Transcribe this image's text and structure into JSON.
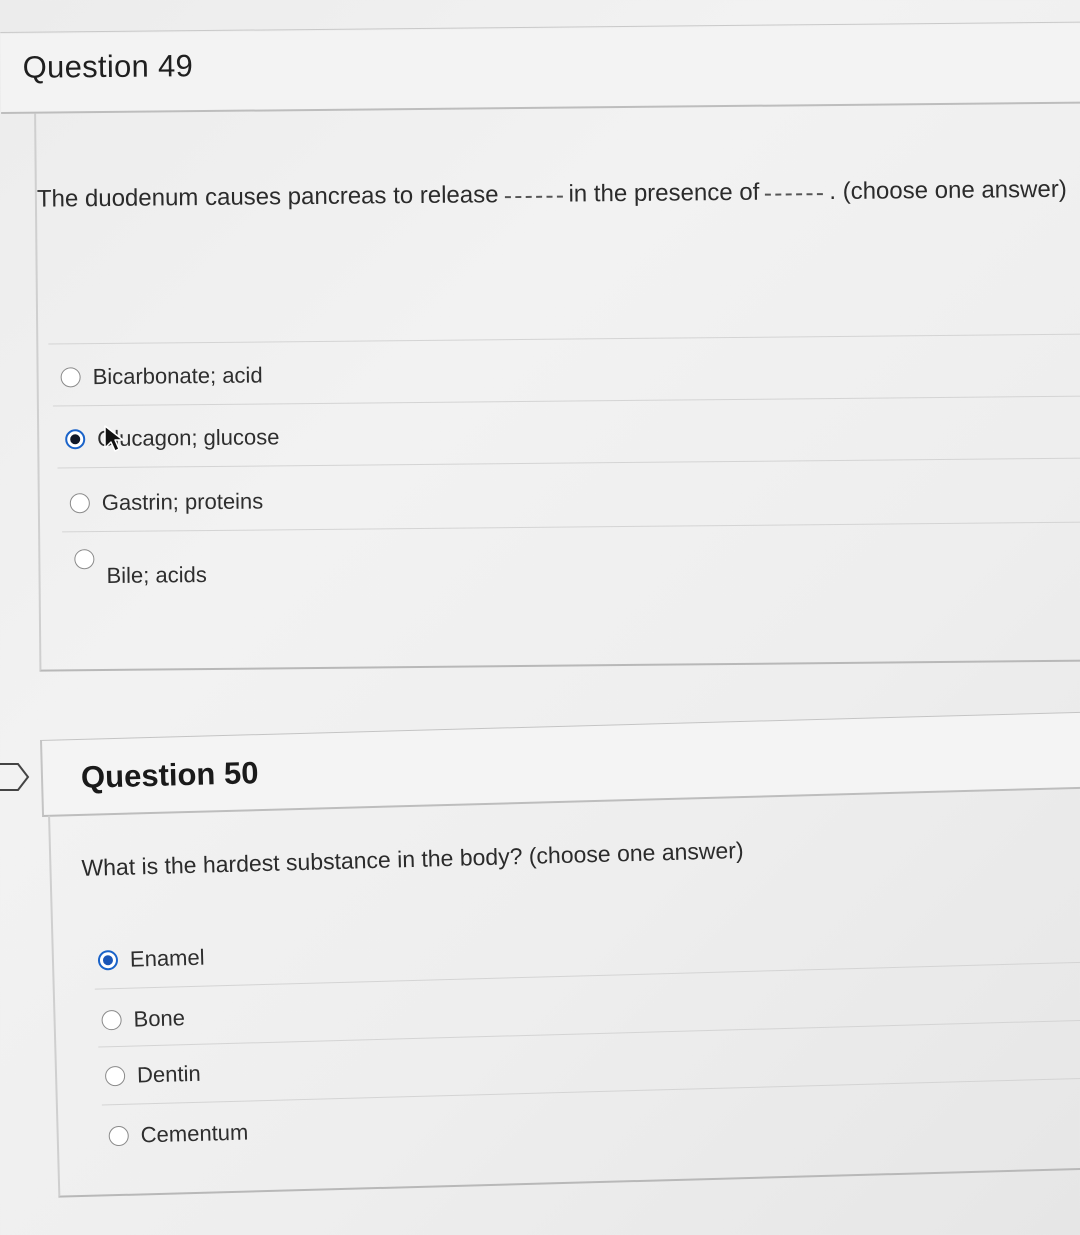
{
  "question49": {
    "title": "Question 49",
    "prompt_part1": "The duodenum causes pancreas to release",
    "prompt_part2": "in the presence of",
    "prompt_part3": ". (choose one answer)",
    "options": [
      {
        "label": "Bicarbonate; acid",
        "selected": false
      },
      {
        "label": "Glucagon; glucose",
        "selected": true
      },
      {
        "label": "Gastrin; proteins",
        "selected": false
      },
      {
        "label": "Bile; acids",
        "selected": false
      }
    ]
  },
  "question50": {
    "title": "Question 50",
    "prompt": "What is the hardest substance in the body? (choose one answer)",
    "options": [
      {
        "label": "Enamel",
        "selected": true
      },
      {
        "label": "Bone",
        "selected": false
      },
      {
        "label": "Dentin",
        "selected": false
      },
      {
        "label": "Cementum",
        "selected": false
      }
    ]
  },
  "icons": {
    "cursor": "mouse-pointer-icon",
    "side": "chevron-right-icon"
  },
  "colors": {
    "selected_radio": "#1a56b8"
  }
}
